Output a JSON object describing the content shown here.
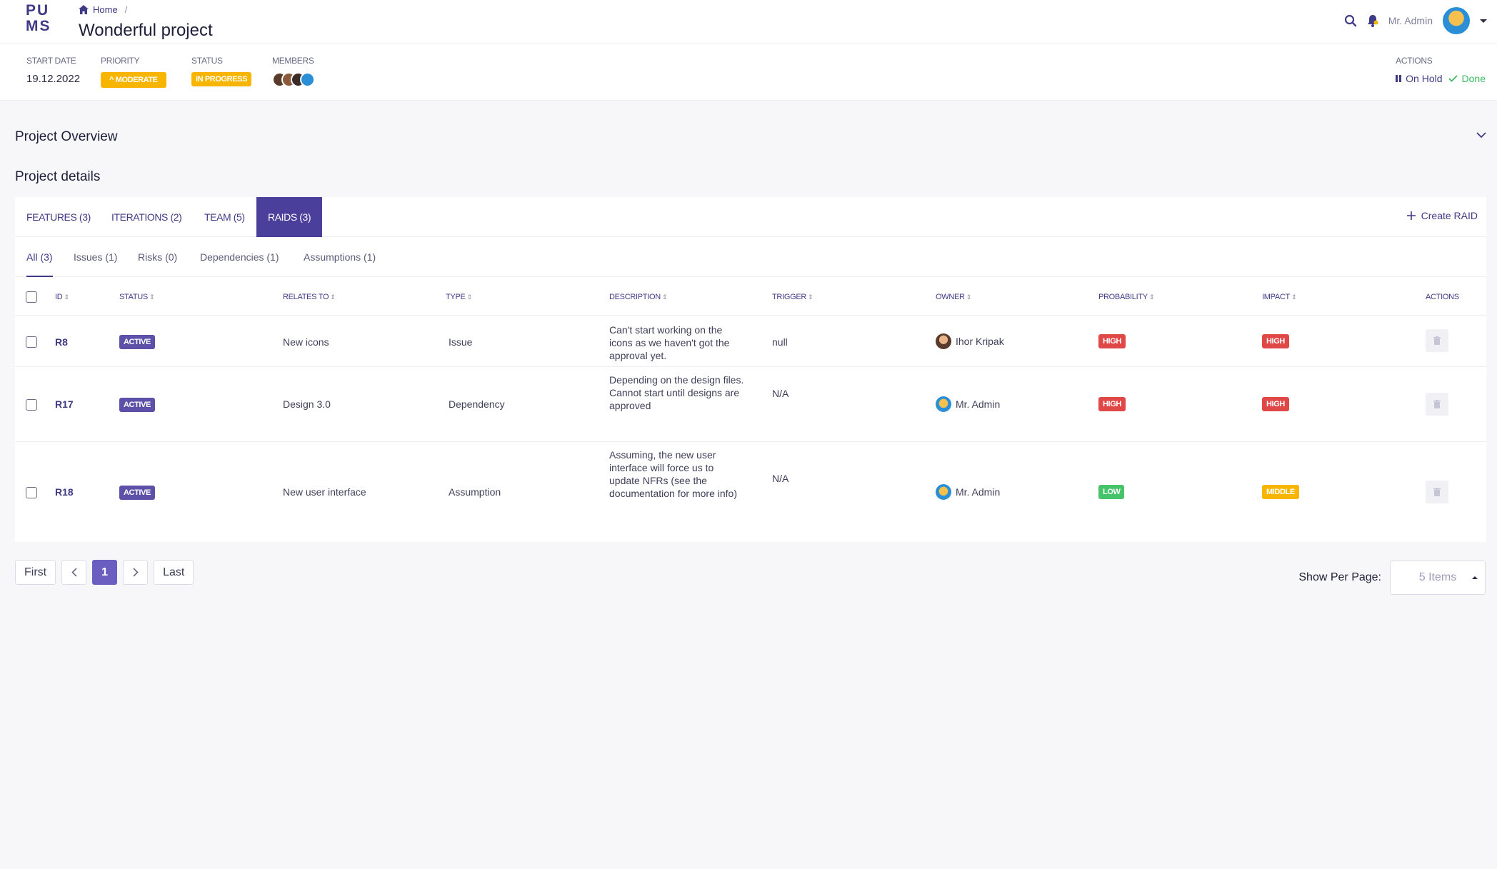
{
  "app": {
    "logo_top": "PU",
    "logo_bottom": "MS"
  },
  "breadcrumb": {
    "home": "Home",
    "separator": "/"
  },
  "page": {
    "title": "Wonderful project"
  },
  "header": {
    "user_name": "Mr. Admin"
  },
  "meta": {
    "start_date_label": "START DATE",
    "start_date": "19.12.2022",
    "priority_label": "PRIORITY",
    "priority": "MODERATE",
    "status_label": "STATUS",
    "status": "IN PROGRESS",
    "members_label": "MEMBERS",
    "actions_label": "ACTIONS",
    "on_hold": "On Hold",
    "done": "Done"
  },
  "sections": {
    "overview": "Project Overview",
    "details": "Project details"
  },
  "tabs": [
    {
      "label": "FEATURES (3)"
    },
    {
      "label": "ITERATIONS (2)"
    },
    {
      "label": "TEAM (5)"
    },
    {
      "label": "RAIDS (3)"
    }
  ],
  "create_raid": "Create RAID",
  "subtabs": [
    {
      "label": "All (3)"
    },
    {
      "label": "Issues (1)"
    },
    {
      "label": "Risks (0)"
    },
    {
      "label": "Dependencies (1)"
    },
    {
      "label": "Assumptions (1)"
    }
  ],
  "table": {
    "headers": {
      "id": "ID",
      "status": "STATUS",
      "relates_to": "RELATES TO",
      "type": "TYPE",
      "description": "DESCRIPTION",
      "trigger": "TRIGGER",
      "owner": "OWNER",
      "probability": "PROBABILITY",
      "impact": "IMPACT",
      "actions": "ACTIONS"
    },
    "rows": [
      {
        "id": "R8",
        "status": "ACTIVE",
        "relates_to": "New icons",
        "type": "Issue",
        "description": "Can't start working on the icons as we haven't got the approval yet.",
        "trigger": "null",
        "owner": "Ihor Kripak",
        "probability": "HIGH",
        "impact": "HIGH"
      },
      {
        "id": "R17",
        "status": "ACTIVE",
        "relates_to": "Design 3.0",
        "type": "Dependency",
        "description": "Depending on the design files. Cannot start until designs are approved",
        "trigger": "N/A",
        "owner": "Mr. Admin",
        "probability": "HIGH",
        "impact": "HIGH"
      },
      {
        "id": "R18",
        "status": "ACTIVE",
        "relates_to": "New user interface",
        "type": "Assumption",
        "description": "Assuming, the new user interface will force us to update NFRs (see the documentation for more info)",
        "trigger": "N/A",
        "owner": "Mr. Admin",
        "probability": "LOW",
        "impact": "MIDDLE"
      }
    ]
  },
  "pagination": {
    "first": "First",
    "current": "1",
    "last": "Last"
  },
  "per_page": {
    "label": "Show Per Page:",
    "value": "5 Items"
  },
  "colors": {
    "brand": "#4b3f9c",
    "accent_yellow": "#f7b500",
    "high": "#e04747",
    "low": "#47c46a",
    "done": "#3dbb5e"
  }
}
